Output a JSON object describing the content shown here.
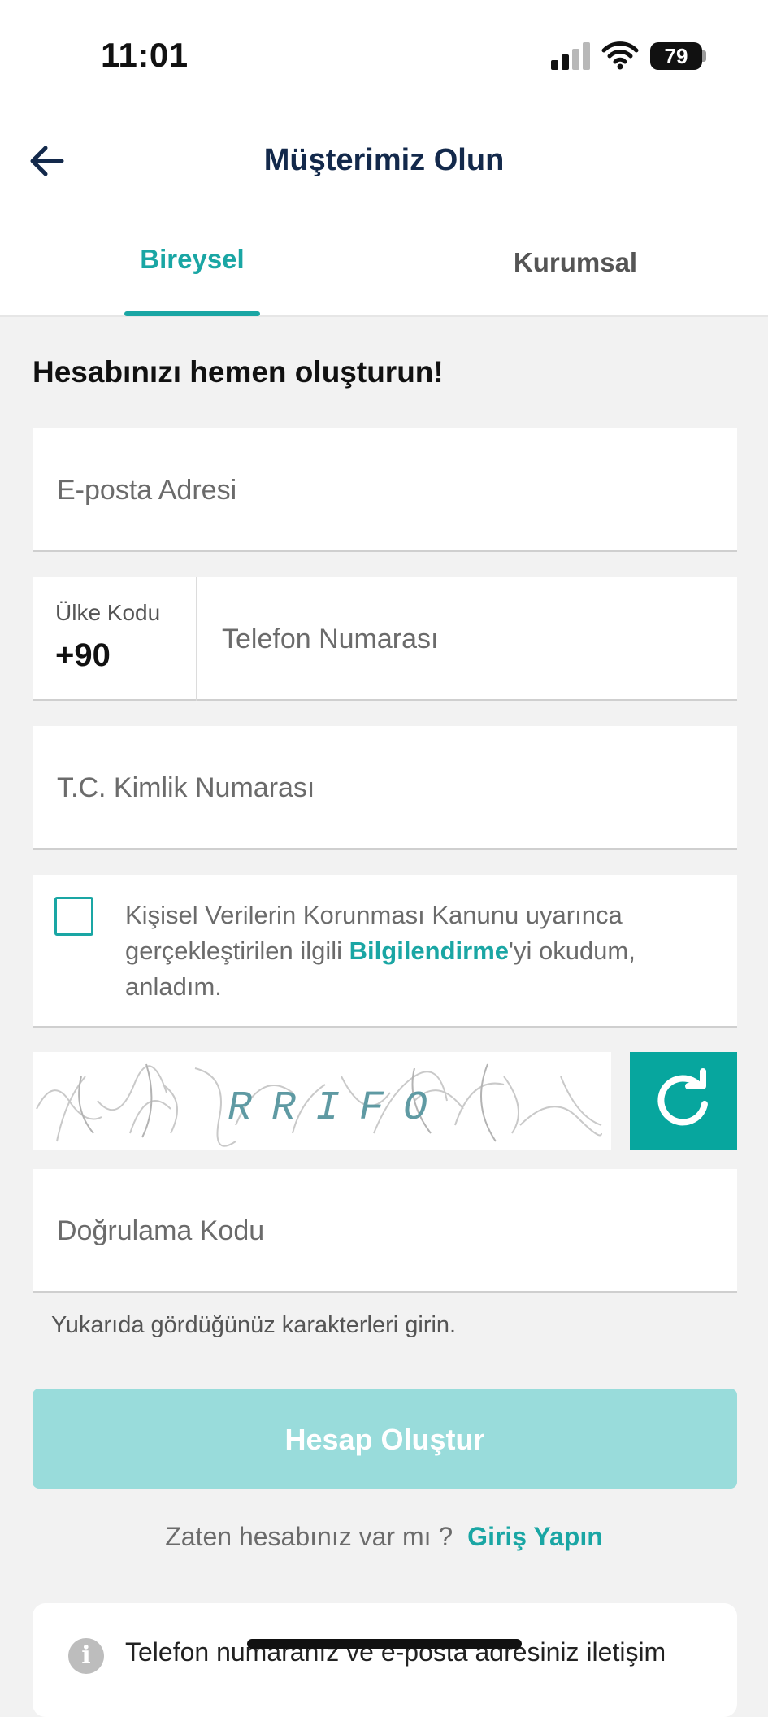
{
  "status_bar": {
    "time": "11:01",
    "battery": "79"
  },
  "header": {
    "title": "Müşterimiz Olun"
  },
  "tabs": [
    {
      "label": "Bireysel",
      "active": true
    },
    {
      "label": "Kurumsal",
      "active": false
    }
  ],
  "form": {
    "heading": "Hesabınızı hemen oluşturun!",
    "email_placeholder": "E-posta Adresi",
    "country_code_label": "Ülke Kodu",
    "country_code_value": "+90",
    "phone_placeholder": "Telefon Numarası",
    "tc_placeholder": "T.C. Kimlik Numarası",
    "consent_before": "Kişisel Verilerin Korunması Kanunu uyarınca gerçekleştirilen ilgili ",
    "consent_link": "Bilgilendirme",
    "consent_after": "'yi okudum, anladım.",
    "captcha_text": "RRIFO",
    "verification_placeholder": "Doğrulama Kodu",
    "verification_hint": "Yukarıda gördüğünüz karakterleri girin.",
    "submit_label": "Hesap Oluştur"
  },
  "login": {
    "question": "Zaten hesabınız var mı ?",
    "link": "Giriş Yapın"
  },
  "info": {
    "text": "Telefon numaranız ve e-posta adresiniz iletişim"
  },
  "colors": {
    "accent": "#1aa6a4",
    "title": "#13294b",
    "submit_disabled": "#99dcdb",
    "refresh": "#07a69e"
  },
  "icons": [
    "back-arrow-icon",
    "refresh-icon",
    "info-icon",
    "wifi-icon",
    "signal-icon",
    "battery-icon"
  ]
}
